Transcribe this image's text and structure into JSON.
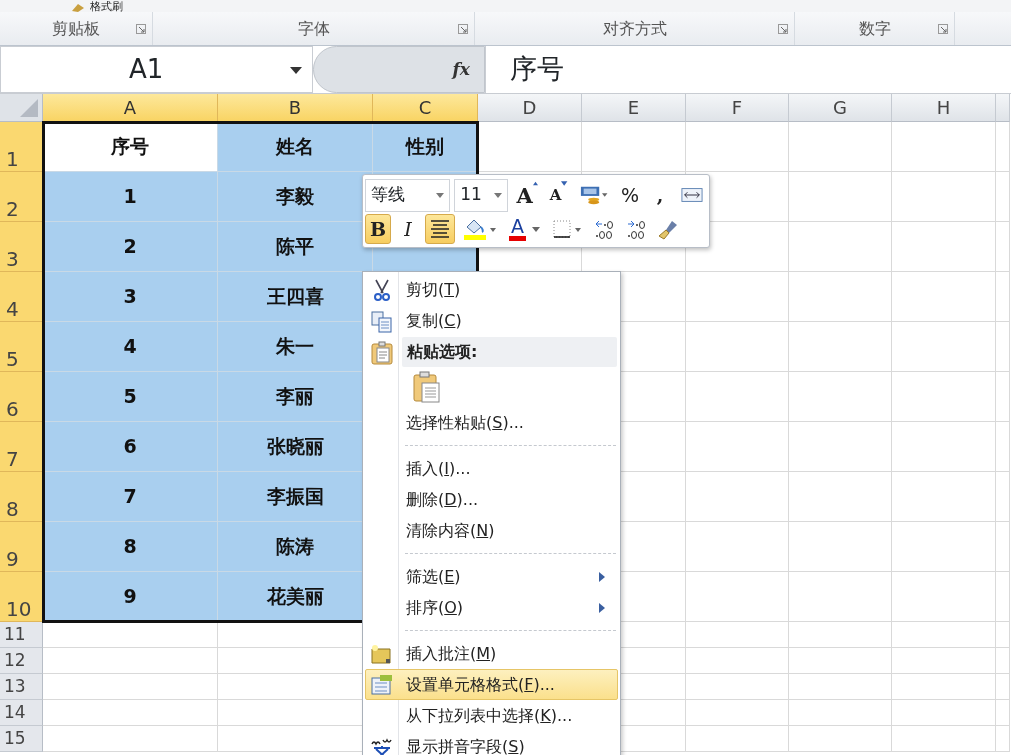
{
  "ribbon": {
    "top_fragment": "格式刷",
    "groups": [
      {
        "label": "剪贴板"
      },
      {
        "label": "字体"
      },
      {
        "label": "对齐方式"
      },
      {
        "label": "数字"
      }
    ]
  },
  "formula_bar": {
    "name_box": "A1",
    "fx": "fx",
    "content": "序号"
  },
  "sheet": {
    "columns": [
      {
        "label": "A",
        "selected": true
      },
      {
        "label": "B",
        "selected": true
      },
      {
        "label": "C",
        "selected": true
      },
      {
        "label": "D",
        "selected": false
      },
      {
        "label": "E",
        "selected": false
      },
      {
        "label": "F",
        "selected": false
      },
      {
        "label": "G",
        "selected": false
      },
      {
        "label": "H",
        "selected": false
      }
    ],
    "rows": [
      {
        "header": "1",
        "selected": true,
        "cells": [
          {
            "text": "序号",
            "selected": true,
            "active": true
          },
          {
            "text": "姓名",
            "selected": true,
            "active": false
          },
          {
            "text": "性别",
            "selected": true,
            "active": false
          }
        ]
      },
      {
        "header": "2",
        "selected": true,
        "cells": [
          {
            "text": "1",
            "selected": true,
            "active": false
          },
          {
            "text": "李毅",
            "selected": true,
            "active": false
          }
        ]
      },
      {
        "header": "3",
        "selected": true,
        "cells": [
          {
            "text": "2",
            "selected": true,
            "active": false
          },
          {
            "text": "陈平",
            "selected": true,
            "active": false
          }
        ]
      },
      {
        "header": "4",
        "selected": true,
        "cells": [
          {
            "text": "3",
            "selected": true,
            "active": false
          },
          {
            "text": "王四喜",
            "selected": true,
            "active": false
          }
        ]
      },
      {
        "header": "5",
        "selected": true,
        "cells": [
          {
            "text": "4",
            "selected": true,
            "active": false
          },
          {
            "text": "朱一",
            "selected": true,
            "active": false
          }
        ]
      },
      {
        "header": "6",
        "selected": true,
        "cells": [
          {
            "text": "5",
            "selected": true,
            "active": false
          },
          {
            "text": "李丽",
            "selected": true,
            "active": false
          }
        ]
      },
      {
        "header": "7",
        "selected": true,
        "cells": [
          {
            "text": "6",
            "selected": true,
            "active": false
          },
          {
            "text": "张晓丽",
            "selected": true,
            "active": false
          }
        ]
      },
      {
        "header": "8",
        "selected": true,
        "cells": [
          {
            "text": "7",
            "selected": true,
            "active": false
          },
          {
            "text": "李振国",
            "selected": true,
            "active": false
          }
        ]
      },
      {
        "header": "9",
        "selected": true,
        "cells": [
          {
            "text": "8",
            "selected": true,
            "active": false
          },
          {
            "text": "陈涛",
            "selected": true,
            "active": false
          }
        ]
      },
      {
        "header": "10",
        "selected": true,
        "cells": [
          {
            "text": "9",
            "selected": true,
            "active": false
          },
          {
            "text": "花美丽",
            "selected": true,
            "active": false
          }
        ]
      },
      {
        "header": "11",
        "selected": false,
        "cells": []
      },
      {
        "header": "12",
        "selected": false,
        "cells": []
      },
      {
        "header": "13",
        "selected": false,
        "cells": []
      },
      {
        "header": "14",
        "selected": false,
        "cells": []
      },
      {
        "header": "15",
        "selected": false,
        "cells": []
      }
    ]
  },
  "mini_toolbar": {
    "font": "等线",
    "size": "11",
    "row1": [
      {
        "kind": "grow-font",
        "text": "A"
      },
      {
        "kind": "shrink-font",
        "text": "A"
      },
      {
        "kind": "accounting"
      },
      {
        "kind": "percent",
        "text": "%"
      },
      {
        "kind": "comma",
        "text": ","
      },
      {
        "kind": "merge"
      }
    ],
    "row2": [
      {
        "kind": "bold",
        "text": "B",
        "pressed": true
      },
      {
        "kind": "italic",
        "text": "I",
        "pressed": false
      },
      {
        "kind": "center",
        "pressed": true
      },
      {
        "kind": "fill"
      },
      {
        "kind": "font-color",
        "text": "A"
      },
      {
        "kind": "borders"
      },
      {
        "kind": "inc-decimal"
      },
      {
        "kind": "dec-decimal"
      },
      {
        "kind": "format-painter"
      }
    ]
  },
  "context_menu": [
    {
      "kind": "item",
      "text": "剪切(",
      "accel": "T",
      "tail": ")",
      "submenu": false,
      "selected": false
    },
    {
      "kind": "item",
      "text": "复制(",
      "accel": "C",
      "tail": ")",
      "submenu": false,
      "selected": false
    },
    {
      "kind": "header",
      "text": "粘贴选项:"
    },
    {
      "kind": "paste-icons"
    },
    {
      "kind": "item",
      "text": "选择性粘贴(",
      "accel": "S",
      "tail": ")...",
      "submenu": false,
      "selected": false
    },
    {
      "kind": "separator"
    },
    {
      "kind": "item",
      "text": "插入(",
      "accel": "I",
      "tail": ")...",
      "submenu": false,
      "selected": false
    },
    {
      "kind": "item",
      "text": "删除(",
      "accel": "D",
      "tail": ")...",
      "submenu": false,
      "selected": false
    },
    {
      "kind": "item",
      "text": "清除内容(",
      "accel": "N",
      "tail": ")",
      "submenu": false,
      "selected": false
    },
    {
      "kind": "separator"
    },
    {
      "kind": "item",
      "text": "筛选(",
      "accel": "E",
      "tail": ")",
      "submenu": true,
      "selected": false
    },
    {
      "kind": "item",
      "text": "排序(",
      "accel": "O",
      "tail": ")",
      "submenu": true,
      "selected": false
    },
    {
      "kind": "separator"
    },
    {
      "kind": "item",
      "text": "插入批注(",
      "accel": "M",
      "tail": ")",
      "submenu": false,
      "selected": false
    },
    {
      "kind": "item",
      "text": "设置单元格格式(",
      "accel": "F",
      "tail": ")...",
      "submenu": false,
      "selected": true
    },
    {
      "kind": "item",
      "text": "从下拉列表中选择(",
      "accel": "K",
      "tail": ")...",
      "submenu": false,
      "selected": false
    },
    {
      "kind": "item",
      "text": "显示拼音字段(",
      "accel": "S",
      "tail": ")",
      "submenu": false,
      "selected": false
    }
  ]
}
